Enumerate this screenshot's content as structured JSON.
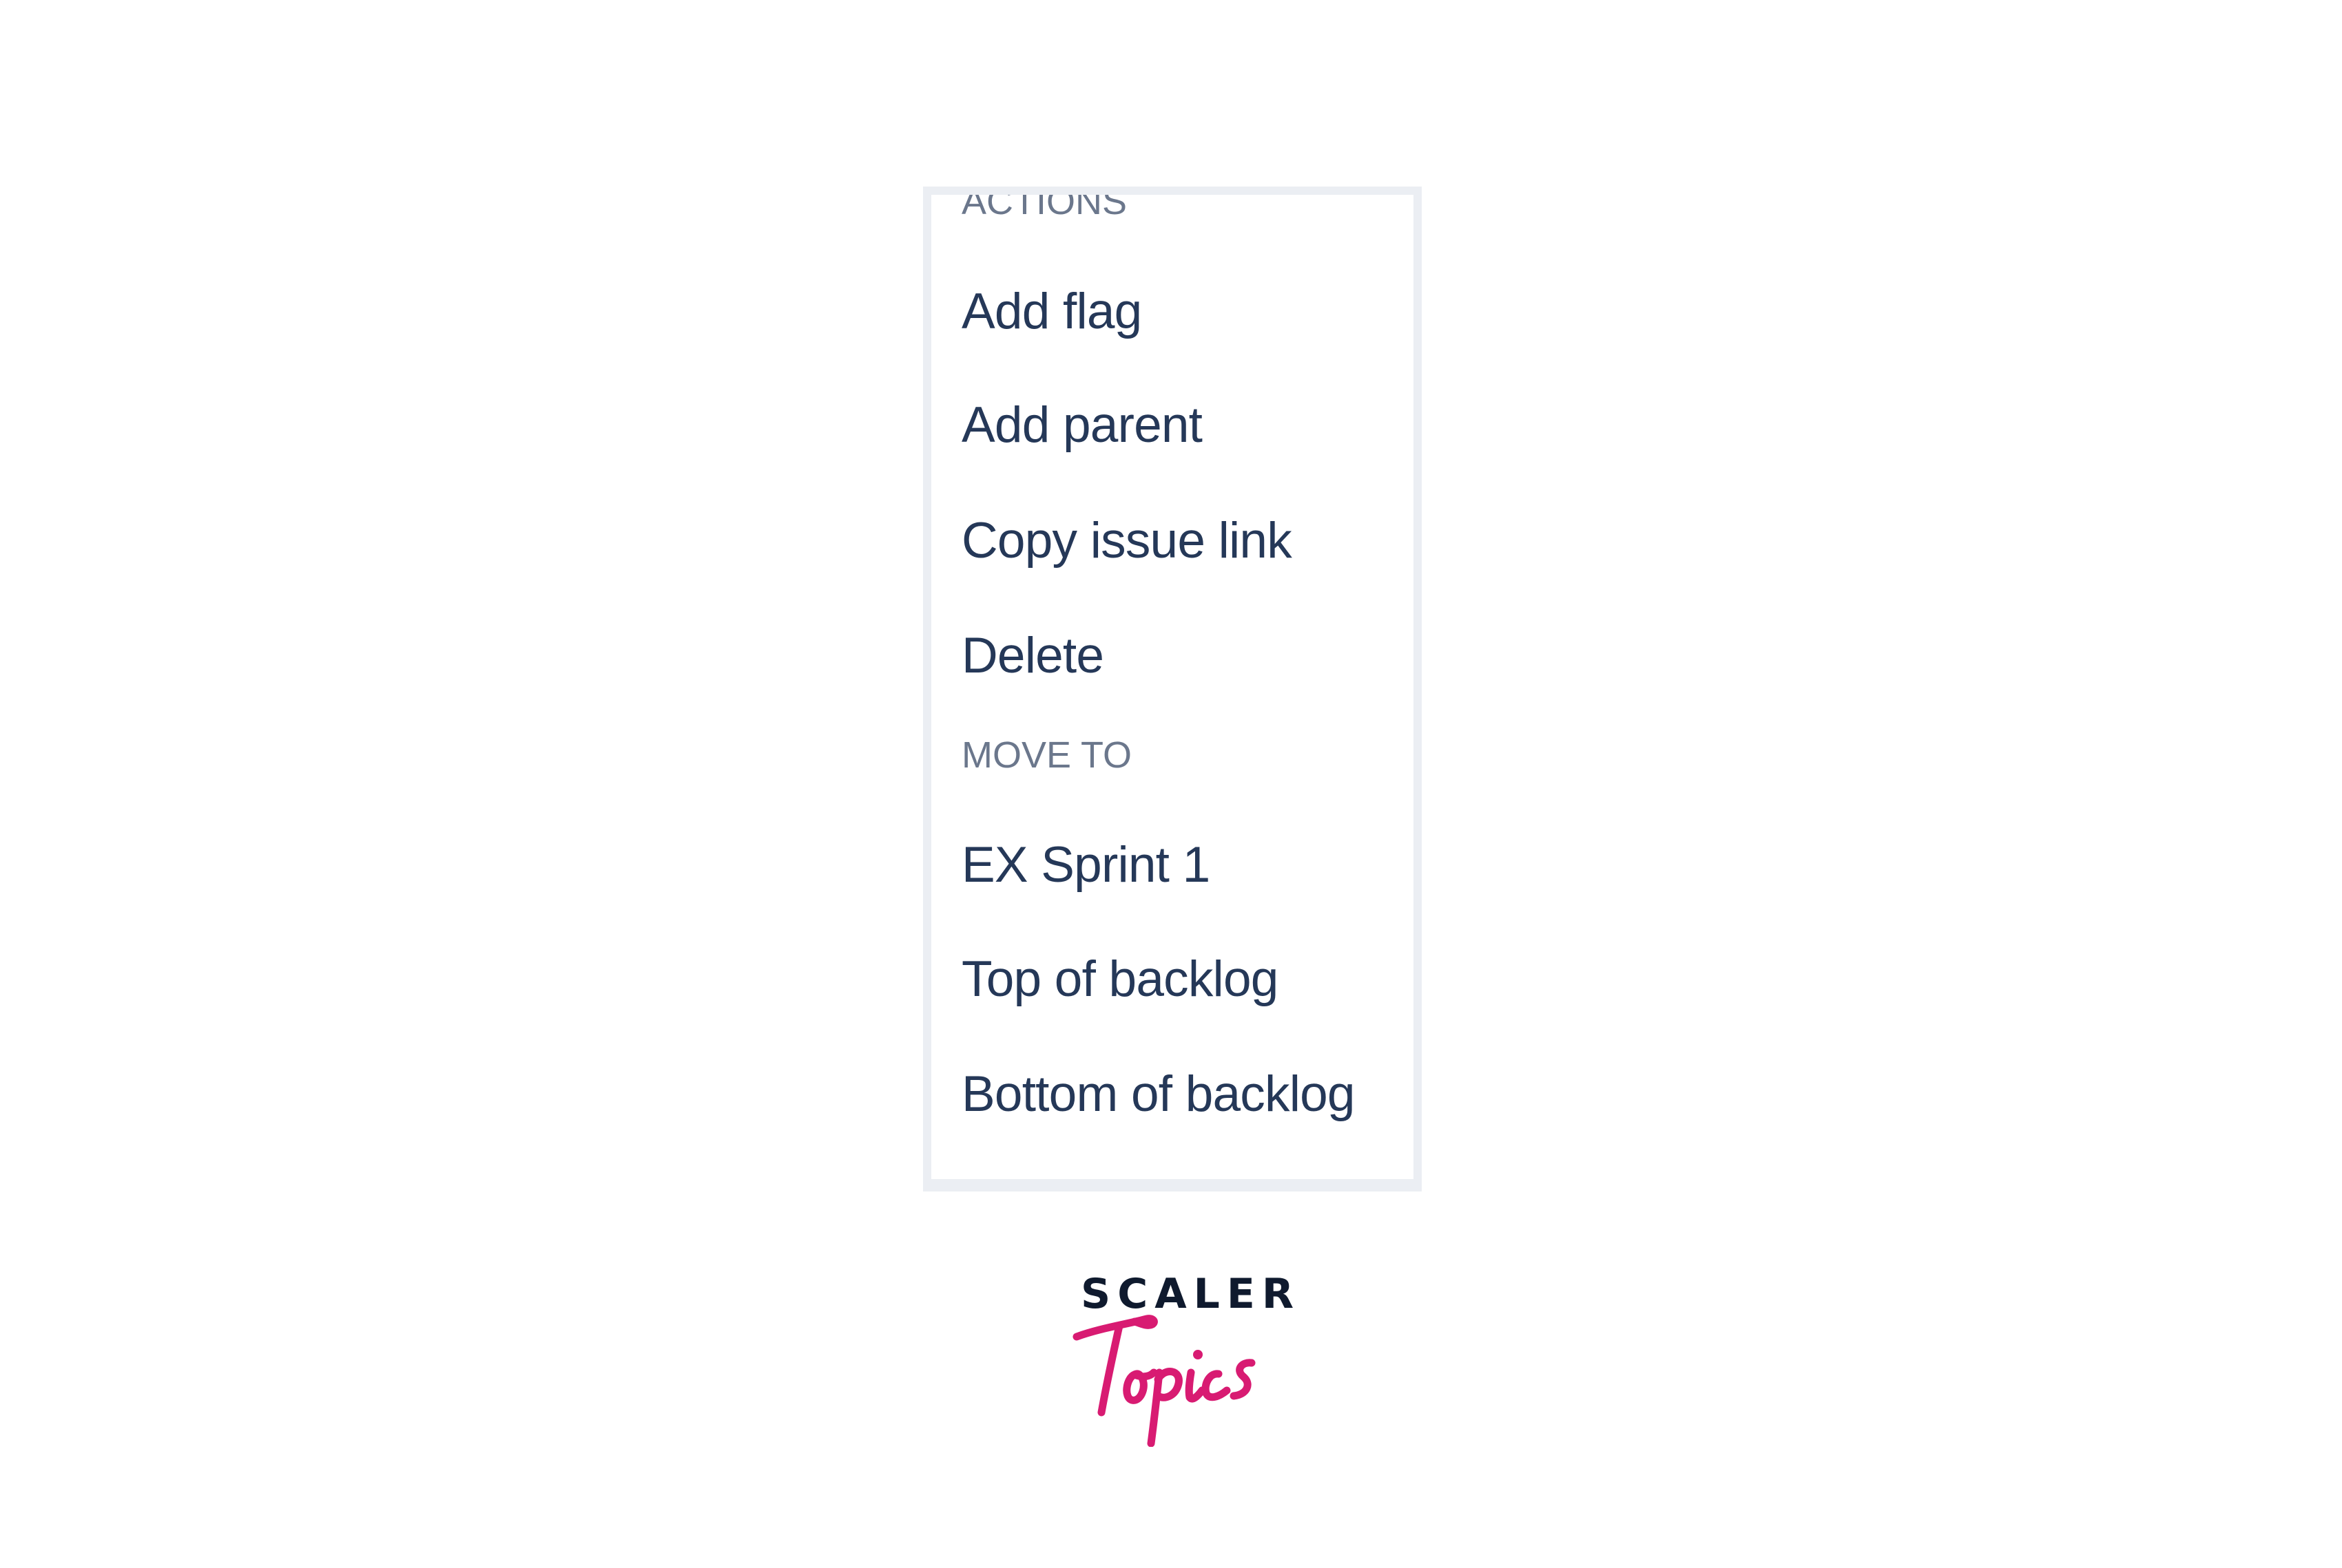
{
  "menu": {
    "sections": [
      {
        "heading": "ACTIONS",
        "items": [
          "Add flag",
          "Add parent",
          "Copy issue link",
          "Delete"
        ]
      },
      {
        "heading": "MOVE TO",
        "items": [
          "EX Sprint 1",
          "Top of backlog",
          "Bottom of backlog"
        ]
      }
    ]
  },
  "logo": {
    "top_text": "SCALER",
    "script_text": "Topics",
    "colors": {
      "top": "#0f1a2e",
      "script": "#d81b72"
    }
  },
  "colors": {
    "item_text": "#253858",
    "heading_text": "#6b778c",
    "frame": "#ebeef3"
  }
}
